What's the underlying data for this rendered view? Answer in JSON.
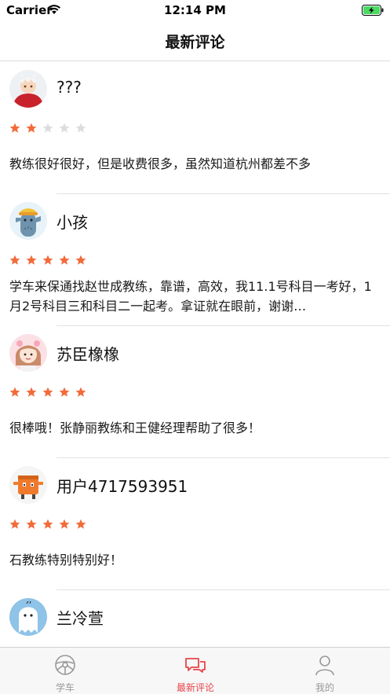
{
  "status_bar": {
    "carrier": "Carrier",
    "time": "12:14 PM"
  },
  "nav": {
    "title": "最新评论"
  },
  "colors": {
    "star_filled": "#f26b3a",
    "star_empty": "#dddddd",
    "tab_active": "#e8454a",
    "tab_inactive": "#999999",
    "battery": "#4cd964"
  },
  "reviews": [
    {
      "username": "???",
      "rating": 2,
      "max_rating": 5,
      "comment": "教练很好很好，但是收费很多，虽然知道杭州都差不多",
      "avatar": "red-character-avatar"
    },
    {
      "username": "小孩",
      "rating": 5,
      "max_rating": 5,
      "comment": "学车来保通找赵世成教练，靠谱，高效，我11.1号科目一考好，1月2号科目三和科目二一起考。拿证就在眼前，谢谢…",
      "avatar": "cactus-character-avatar"
    },
    {
      "username": "苏臣橡橡",
      "rating": 5,
      "max_rating": 5,
      "comment": "很棒哦！张静丽教练和王健经理帮助了很多！",
      "avatar": "girl-avatar"
    },
    {
      "username": "用户4717593951",
      "rating": 5,
      "max_rating": 5,
      "comment": "石教练特别特别好！",
      "avatar": "orange-box-avatar"
    },
    {
      "username": "兰冷萱",
      "rating": 0,
      "max_rating": 5,
      "comment": "",
      "avatar": "ghost-avatar"
    }
  ],
  "tabs": [
    {
      "label": "学车",
      "icon": "steering-wheel-icon",
      "active": false
    },
    {
      "label": "最新评论",
      "icon": "chat-bubbles-icon",
      "active": true
    },
    {
      "label": "我的",
      "icon": "person-icon",
      "active": false
    }
  ]
}
